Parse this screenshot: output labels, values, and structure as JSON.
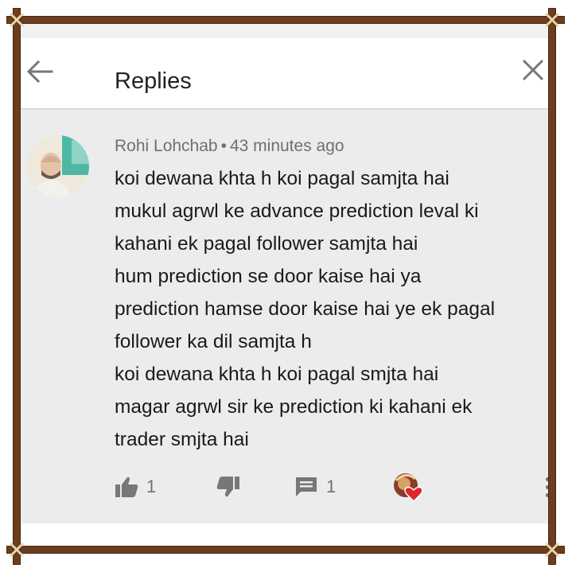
{
  "header": {
    "title": "Replies",
    "back_icon": "arrow-back-icon",
    "close_icon": "close-icon"
  },
  "comment": {
    "author": "Rohi Lohchab",
    "separator": "•",
    "time": "43 minutes ago",
    "lines": [
      "koi dewana khta h koi pagal samjta hai",
      "mukul agrwl ke advance prediction leval ki",
      "kahani ek pagal follower samjta hai",
      "hum prediction se door kaise hai ya",
      "prediction hamse door kaise hai ye ek pagal",
      "follower ka dil  samjta h",
      "koi dewana khta h koi pagal smjta hai",
      "magar agrwl sir ke prediction ki kahani ek",
      "trader smjta hai"
    ],
    "likes": "1",
    "replies": "1"
  },
  "icons": {
    "like": "thumbs-up-icon",
    "dislike": "thumbs-down-icon",
    "reply": "reply-icon",
    "creator_heart": "creator-heart-icon",
    "more": "more-vert-icon"
  },
  "colors": {
    "frame": "#6b3e1f",
    "header_bg": "#ffffff",
    "comment_bg": "#ececec",
    "heart": "#e0262b"
  }
}
